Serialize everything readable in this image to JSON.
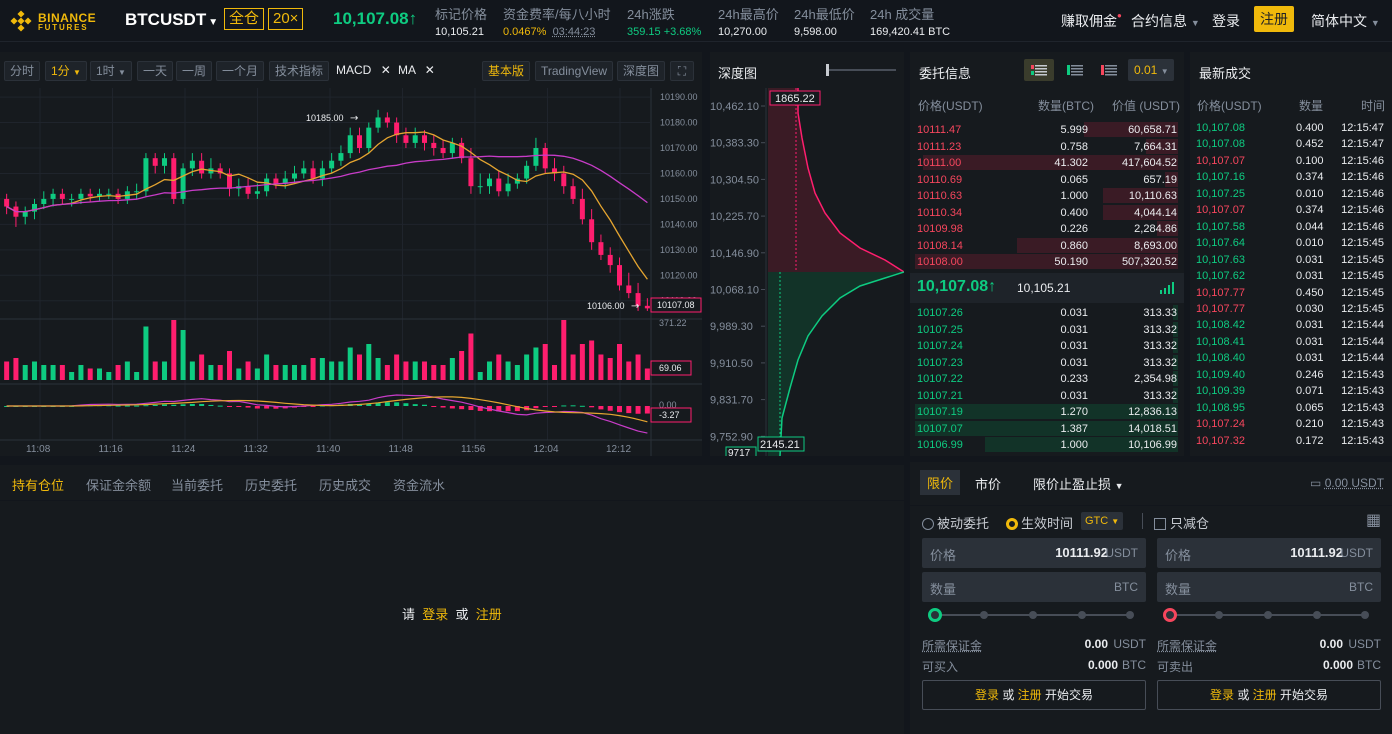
{
  "header": {
    "logo_line1": "BINANCE",
    "logo_line2": "FUTURES",
    "pair": "BTCUSDT",
    "margin_mode": "全仓",
    "leverage": "20×",
    "last_price": "10,107.08↑",
    "mark_price_label": "标记价格",
    "mark_price": "10,105.21",
    "funding_label": "资金费率/每八小时",
    "funding_rate": "0.0467%",
    "funding_countdown": "03:44:23",
    "change_label": "24h涨跌",
    "change_value": "359.15 +3.68%",
    "high_label": "24h最高价",
    "high_value": "10,270.00",
    "low_label": "24h最低价",
    "low_value": "9,598.00",
    "volume_label": "24h 成交量",
    "volume_value": "169,420.41 BTC",
    "nav_referral": "赚取佣金",
    "nav_contract_info": "合约信息",
    "nav_login": "登录",
    "nav_register": "注册",
    "nav_language": "简体中文"
  },
  "chart_toolbar": {
    "btn_time": "分时",
    "btn_1m": "1分",
    "btn_1h": "1时",
    "btn_1d": "一天",
    "btn_1w": "一周",
    "btn_1mo": "一个月",
    "btn_indicators": "技术指标",
    "ind_macd": "MACD",
    "ind_ma": "MA",
    "btn_basic": "基本版",
    "btn_tradingview": "TradingView",
    "btn_depth": "深度图"
  },
  "chart": {
    "price_axis": [
      "10190.00",
      "10180.00",
      "10170.00",
      "10160.00",
      "10150.00",
      "10140.00",
      "10130.00",
      "10120.00",
      "10110.00"
    ],
    "time_axis": [
      "11:08",
      "11:16",
      "11:24",
      "11:32",
      "11:40",
      "11:48",
      "11:56",
      "12:04",
      "12:12"
    ],
    "high_annotation": "10185.00",
    "low_annotation": "10106.00",
    "current_label": "10107.08",
    "volume_max": "371.22",
    "volume_current": "69.06",
    "macd_zero": "0.00",
    "macd_current": "-3.27"
  },
  "chart_data": {
    "type": "candlestick",
    "title": "BTCUSDT 1分",
    "xlabel": "",
    "ylabel": "",
    "ylim": [
      10104,
      10192
    ],
    "x": [
      "11:04",
      "11:05",
      "11:06",
      "11:07",
      "11:08",
      "11:09",
      "11:10",
      "11:11",
      "11:12",
      "11:13",
      "11:14",
      "11:15",
      "11:16",
      "11:17",
      "11:18",
      "11:19",
      "11:20",
      "11:21",
      "11:22",
      "11:23",
      "11:24",
      "11:25",
      "11:26",
      "11:27",
      "11:28",
      "11:29",
      "11:30",
      "11:31",
      "11:32",
      "11:33",
      "11:34",
      "11:35",
      "11:36",
      "11:37",
      "11:38",
      "11:39",
      "11:40",
      "11:41",
      "11:42",
      "11:43",
      "11:44",
      "11:45",
      "11:46",
      "11:47",
      "11:48",
      "11:49",
      "11:50",
      "11:51",
      "11:52",
      "11:53",
      "11:54",
      "11:55",
      "11:56",
      "11:57",
      "11:58",
      "11:59",
      "12:00",
      "12:01",
      "12:02",
      "12:03",
      "12:04",
      "12:05",
      "12:06",
      "12:07",
      "12:08",
      "12:09",
      "12:10",
      "12:11",
      "12:12",
      "12:13"
    ],
    "series": [
      {
        "name": "open",
        "values": [
          10150,
          10147,
          10143,
          10145,
          10148,
          10150,
          10152,
          10150,
          10150,
          10152,
          10151,
          10152,
          10152,
          10150,
          10153,
          10153,
          10166,
          10163,
          10166,
          10150,
          10162,
          10165,
          10160,
          10162,
          10160,
          10154,
          10155,
          10152,
          10153,
          10158,
          10156,
          10158,
          10160,
          10162,
          10158,
          10162,
          10165,
          10168,
          10175,
          10170,
          10178,
          10182,
          10180,
          10175,
          10172,
          10175,
          10172,
          10170,
          10168,
          10172,
          10166,
          10155,
          10155,
          10158,
          10153,
          10156,
          10158,
          10163,
          10170,
          10162,
          10160,
          10155,
          10150,
          10142,
          10133,
          10128,
          10124,
          10116,
          10113,
          10108
        ]
      },
      {
        "name": "close",
        "values": [
          10147,
          10143,
          10145,
          10148,
          10150,
          10152,
          10150,
          10150,
          10152,
          10151,
          10152,
          10152,
          10150,
          10153,
          10153,
          10166,
          10163,
          10166,
          10150,
          10162,
          10165,
          10160,
          10162,
          10160,
          10154,
          10155,
          10152,
          10153,
          10158,
          10156,
          10158,
          10160,
          10162,
          10158,
          10162,
          10165,
          10168,
          10175,
          10170,
          10178,
          10182,
          10180,
          10175,
          10172,
          10175,
          10172,
          10170,
          10168,
          10172,
          10166,
          10155,
          10155,
          10158,
          10153,
          10156,
          10158,
          10163,
          10170,
          10162,
          10160,
          10155,
          10150,
          10142,
          10133,
          10128,
          10124,
          10116,
          10113,
          10108,
          10107
        ]
      },
      {
        "name": "high",
        "values": [
          10152,
          10149,
          10147,
          10150,
          10153,
          10154,
          10154,
          10152,
          10154,
          10154,
          10154,
          10154,
          10154,
          10155,
          10156,
          10168,
          10168,
          10168,
          10168,
          10164,
          10168,
          10168,
          10166,
          10164,
          10162,
          10158,
          10158,
          10156,
          10160,
          10160,
          10161,
          10163,
          10165,
          10165,
          10165,
          10168,
          10171,
          10178,
          10178,
          10180,
          10185,
          10184,
          10182,
          10178,
          10178,
          10177,
          10175,
          10173,
          10174,
          10174,
          10170,
          10160,
          10160,
          10161,
          10160,
          10160,
          10165,
          10174,
          10172,
          10166,
          10163,
          10158,
          10154,
          10146,
          10136,
          10131,
          10127,
          10121,
          10117,
          10111
        ]
      },
      {
        "name": "low",
        "values": [
          10144,
          10139,
          10140,
          10142,
          10146,
          10147,
          10148,
          10147,
          10148,
          10149,
          10149,
          10150,
          10148,
          10148,
          10150,
          10151,
          10160,
          10160,
          10148,
          10148,
          10159,
          10158,
          10158,
          10158,
          10151,
          10151,
          10150,
          10150,
          10151,
          10154,
          10154,
          10156,
          10158,
          10156,
          10155,
          10160,
          10163,
          10166,
          10168,
          10168,
          10176,
          10178,
          10172,
          10170,
          10170,
          10169,
          10167,
          10166,
          10166,
          10164,
          10152,
          10152,
          10152,
          10151,
          10151,
          10154,
          10156,
          10161,
          10160,
          10157,
          10152,
          10148,
          10140,
          10130,
          10126,
          10121,
          10114,
          10111,
          10106,
          10106
        ]
      }
    ]
  },
  "depth": {
    "title": "深度图",
    "axis": [
      "10,462.10",
      "10,383.30",
      "10,304.50",
      "10,225.70",
      "10,146.90",
      "10,068.10",
      "9,989.30",
      "9,910.50",
      "9,831.70",
      "9,752.90"
    ],
    "top_label": "1865.22",
    "bottom_label": "2145.21",
    "bottom_partial": "9717"
  },
  "orderbook": {
    "title": "委托信息",
    "precision": "0.01",
    "col_price": "价格(USDT)",
    "col_amount": "数量(BTC)",
    "col_value": "价值 (USDT)",
    "asks": [
      {
        "price": "10111.47",
        "amount": "5.999",
        "value": "60,658.71",
        "depth": 0.35
      },
      {
        "price": "10111.23",
        "amount": "0.758",
        "value": "7,664.31",
        "depth": 0.12
      },
      {
        "price": "10111.00",
        "amount": "41.302",
        "value": "417,604.52",
        "depth": 0.95
      },
      {
        "price": "10110.69",
        "amount": "0.065",
        "value": "657.19",
        "depth": 0.05
      },
      {
        "price": "10110.63",
        "amount": "1.000",
        "value": "10,110.63",
        "depth": 0.28
      },
      {
        "price": "10110.34",
        "amount": "0.400",
        "value": "4,044.14",
        "depth": 0.28
      },
      {
        "price": "10109.98",
        "amount": "0.226",
        "value": "2,284.86",
        "depth": 0.08
      },
      {
        "price": "10108.14",
        "amount": "0.860",
        "value": "8,693.00",
        "depth": 0.6
      },
      {
        "price": "10108.00",
        "amount": "50.190",
        "value": "507,320.52",
        "depth": 0.98
      }
    ],
    "mid_price": "10,107.08↑",
    "mid_mark": "10,105.21",
    "bids": [
      {
        "price": "10107.26",
        "amount": "0.031",
        "value": "313.33",
        "depth": 0.02
      },
      {
        "price": "10107.25",
        "amount": "0.031",
        "value": "313.32",
        "depth": 0.02
      },
      {
        "price": "10107.24",
        "amount": "0.031",
        "value": "313.32",
        "depth": 0.02
      },
      {
        "price": "10107.23",
        "amount": "0.031",
        "value": "313.32",
        "depth": 0.02
      },
      {
        "price": "10107.22",
        "amount": "0.233",
        "value": "2,354.98",
        "depth": 0.02
      },
      {
        "price": "10107.21",
        "amount": "0.031",
        "value": "313.32",
        "depth": 0.02
      },
      {
        "price": "10107.19",
        "amount": "1.270",
        "value": "12,836.13",
        "depth": 0.98
      },
      {
        "price": "10107.07",
        "amount": "1.387",
        "value": "14,018.51",
        "depth": 0.98
      },
      {
        "price": "10106.99",
        "amount": "1.000",
        "value": "10,106.99",
        "depth": 0.72
      }
    ]
  },
  "trades": {
    "title": "最新成交",
    "col_price": "价格(USDT)",
    "col_amount": "数量",
    "col_time": "时间",
    "rows": [
      {
        "price": "10,107.08",
        "amount": "0.400",
        "time": "12:15:47",
        "side": "buy"
      },
      {
        "price": "10,107.08",
        "amount": "0.452",
        "time": "12:15:47",
        "side": "buy"
      },
      {
        "price": "10,107.07",
        "amount": "0.100",
        "time": "12:15:46",
        "side": "sell"
      },
      {
        "price": "10,107.16",
        "amount": "0.374",
        "time": "12:15:46",
        "side": "buy"
      },
      {
        "price": "10,107.25",
        "amount": "0.010",
        "time": "12:15:46",
        "side": "buy"
      },
      {
        "price": "10,107.07",
        "amount": "0.374",
        "time": "12:15:46",
        "side": "sell"
      },
      {
        "price": "10,107.58",
        "amount": "0.044",
        "time": "12:15:46",
        "side": "buy"
      },
      {
        "price": "10,107.64",
        "amount": "0.010",
        "time": "12:15:45",
        "side": "buy"
      },
      {
        "price": "10,107.63",
        "amount": "0.031",
        "time": "12:15:45",
        "side": "buy"
      },
      {
        "price": "10,107.62",
        "amount": "0.031",
        "time": "12:15:45",
        "side": "buy"
      },
      {
        "price": "10,107.77",
        "amount": "0.450",
        "time": "12:15:45",
        "side": "sell"
      },
      {
        "price": "10,107.77",
        "amount": "0.030",
        "time": "12:15:45",
        "side": "sell"
      },
      {
        "price": "10,108.42",
        "amount": "0.031",
        "time": "12:15:44",
        "side": "buy"
      },
      {
        "price": "10,108.41",
        "amount": "0.031",
        "time": "12:15:44",
        "side": "buy"
      },
      {
        "price": "10,108.40",
        "amount": "0.031",
        "time": "12:15:44",
        "side": "buy"
      },
      {
        "price": "10,109.40",
        "amount": "0.246",
        "time": "12:15:43",
        "side": "buy"
      },
      {
        "price": "10,109.39",
        "amount": "0.071",
        "time": "12:15:43",
        "side": "buy"
      },
      {
        "price": "10,108.95",
        "amount": "0.065",
        "time": "12:15:43",
        "side": "buy"
      },
      {
        "price": "10,107.24",
        "amount": "0.210",
        "time": "12:15:43",
        "side": "sell"
      },
      {
        "price": "10,107.32",
        "amount": "0.172",
        "time": "12:15:43",
        "side": "sell"
      }
    ]
  },
  "positions": {
    "tabs": [
      "持有仓位",
      "保证金余额",
      "当前委托",
      "历史委托",
      "历史成交",
      "资金流水"
    ],
    "msg_please": "请",
    "msg_login": "登录",
    "msg_or": "或",
    "msg_register": "注册"
  },
  "order_form": {
    "tab_limit": "限价",
    "tab_market": "市价",
    "tab_stop": "限价止盈止损",
    "balance": "0.00 USDT",
    "opt_post_only": "被动委托",
    "opt_tif": "生效时间",
    "tif_value": "GTC",
    "opt_reduce_only": "只减仓",
    "buy": {
      "price_label": "价格",
      "price_value": "10111.92",
      "price_unit": "USDT",
      "qty_label": "数量",
      "qty_unit": "BTC",
      "margin_label": "所需保证金",
      "margin_value": "0.00",
      "margin_unit": "USDT",
      "avail_label": "可买入",
      "avail_value": "0.000",
      "avail_unit": "BTC",
      "btn_login": "登录",
      "btn_or": "或",
      "btn_register": "注册",
      "btn_rest": "开始交易"
    },
    "sell": {
      "price_label": "价格",
      "price_value": "10111.92",
      "price_unit": "USDT",
      "qty_label": "数量",
      "qty_unit": "BTC",
      "margin_label": "所需保证金",
      "margin_value": "0.00",
      "margin_unit": "USDT",
      "avail_label": "可卖出",
      "avail_value": "0.000",
      "avail_unit": "BTC",
      "btn_login": "登录",
      "btn_or": "或",
      "btn_register": "注册",
      "btn_rest": "开始交易"
    }
  },
  "colors": {
    "brand": "#f0b90b",
    "buy": "#0ecb81",
    "sell": "#f6465d",
    "candle_up": "#0ecb81",
    "candle_down": "#ff1e6e",
    "ma_fast": "#e5a530",
    "ma_slow": "#c83cc8"
  }
}
